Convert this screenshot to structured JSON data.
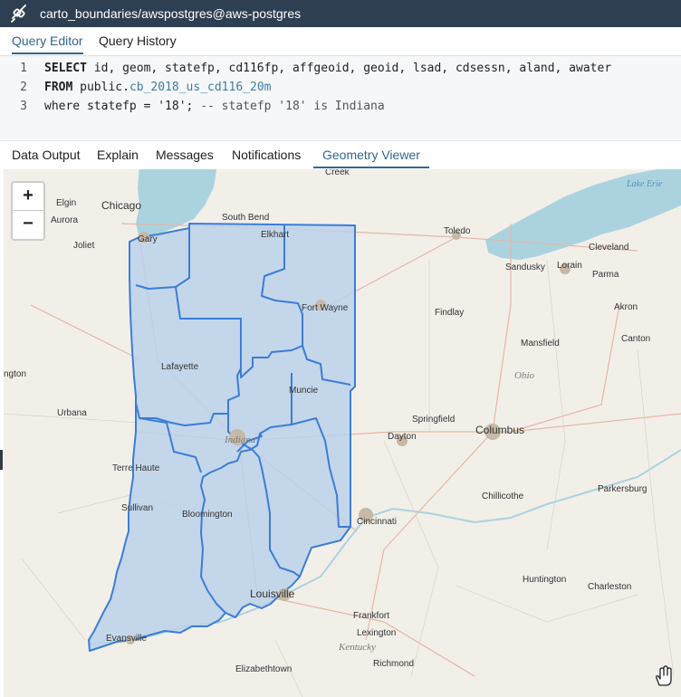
{
  "titlebar": {
    "title": "carto_boundaries/awspostgres@aws-postgres",
    "icon": "connection-icon"
  },
  "query_tabs": [
    {
      "label": "Query Editor",
      "active": true
    },
    {
      "label": "Query History",
      "active": false
    }
  ],
  "editor": {
    "line_numbers": [
      "1",
      "2",
      "3"
    ],
    "line1": {
      "kw": "SELECT",
      "rest": " id, geom, statefp, cd116fp, affgeoid, geoid, lsad, cdsessn, aland, awater"
    },
    "line2": {
      "kw": "FROM",
      "schema": " public.",
      "table": "cb_2018_us_cd116_20m"
    },
    "line3": {
      "kw": "where",
      "rest": " statefp = ",
      "str": "'18'",
      "semi": "; ",
      "comment": "-- statefp '18' is Indiana"
    }
  },
  "result_tabs": [
    {
      "label": "Data Output",
      "active": false
    },
    {
      "label": "Explain",
      "active": false
    },
    {
      "label": "Messages",
      "active": false
    },
    {
      "label": "Notifications",
      "active": false
    },
    {
      "label": "Geometry Viewer",
      "active": true
    }
  ],
  "map": {
    "zoom_in_label": "+",
    "zoom_out_label": "−",
    "geometry_fill": "#bcd1ea",
    "geometry_stroke": "#3b7dd8",
    "lake_color": "#aad3df",
    "land_color": "#f2efe9",
    "labels": {
      "chicago": "Chicago",
      "elgin": "Elgin",
      "aurora": "Aurora",
      "joliet": "Joliet",
      "gary": "Gary",
      "south_bend": "South Bend",
      "elkhart": "Elkhart",
      "toledo": "Toledo",
      "lake_erie": "Lake Erie",
      "cleveland": "Cleveland",
      "sandusky": "Sandusky",
      "lorain": "Lorain",
      "parma": "Parma",
      "akron": "Akron",
      "canton": "Canton",
      "fort_wayne": "Fort Wayne",
      "findlay": "Findlay",
      "mansfield": "Mansfield",
      "ohio": "Ohio",
      "lafayette": "Lafayette",
      "muncie": "Muncie",
      "bloomington_il": "ngton",
      "urbana": "Urbana",
      "indiana": "Indiana",
      "springfield": "Springfield",
      "dayton": "Dayton",
      "columbus": "Columbus",
      "terre_haute": "Terre Haute",
      "sullivan": "Sullivan",
      "bloomington": "Bloomington",
      "cincinnati": "Cincinnati",
      "chillicothe": "Chillicothe",
      "parkersburg": "Parkersburg",
      "louisville": "Louisville",
      "huntington": "Huntington",
      "charleston": "Charleston",
      "frankfort": "Frankfort",
      "lexington": "Lexington",
      "kentucky": "Kentucky",
      "richmond": "Richmond",
      "evansville": "Evansville",
      "elizabethtown": "Elizabethtown",
      "creek": "Creek"
    }
  }
}
